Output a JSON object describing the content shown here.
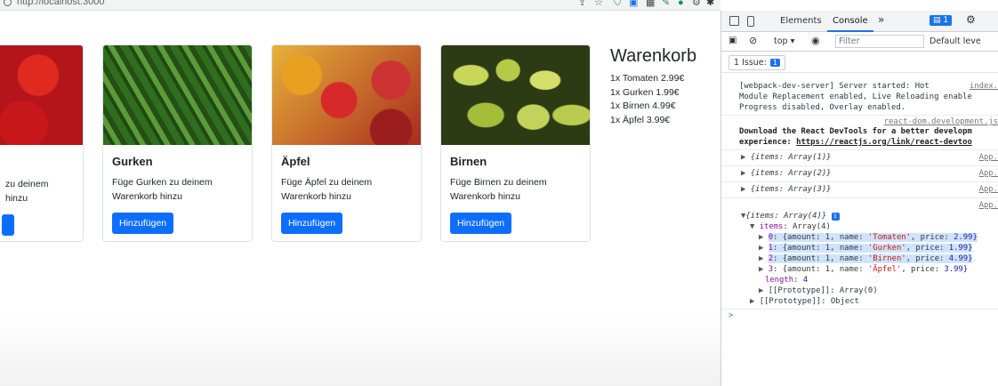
{
  "browser": {
    "url": "http://localhost:3000"
  },
  "products": [
    {
      "name": "",
      "desc_line1": "zu deinem",
      "desc_line2": "hinzu",
      "button": ""
    },
    {
      "name": "Gurken",
      "desc_line1": "Füge Gurken zu deinem",
      "desc_line2": "Warenkorb hinzu",
      "button": "Hinzufügen"
    },
    {
      "name": "Äpfel",
      "desc_line1": "Füge Äpfel zu deinem",
      "desc_line2": "Warenkorb hinzu",
      "button": "Hinzufügen"
    },
    {
      "name": "Birnen",
      "desc_line1": "Füge Birnen zu deinem",
      "desc_line2": "Warenkorb hinzu",
      "button": "Hinzufügen"
    }
  ],
  "cart": {
    "title": "Warenkorb",
    "lines": [
      "1x Tomaten 2.99€",
      "1x Gurken 1.99€",
      "1x Birnen 4.99€",
      "1x Äpfel 3.99€"
    ]
  },
  "devtools": {
    "tabs": [
      "Elements",
      "Console"
    ],
    "more": "»",
    "msg_count": "1",
    "context": "top",
    "filter_placeholder": "Filter",
    "levels": "Default leve",
    "issues": "1 Issue:",
    "issues_count": "1",
    "log_wds_1": "[webpack-dev-server] Server started: Hot",
    "log_wds_src": "index.",
    "log_wds_2": "Module Replacement enabled, Live Reloading enable",
    "log_wds_3": "Progress disabled, Overlay enabled.",
    "log_react_src": "react-dom.development.js",
    "log_react_1": "Download the React DevTools for a better developm",
    "log_react_2a": "experience: ",
    "log_react_2b": "https://reactjs.org/link/react-devtoo",
    "obj1": "{items: Array(1)}",
    "obj2": "{items: Array(2)}",
    "obj3": "{items: Array(3)}",
    "obj4": "{items: Array(4)}",
    "app_src": "App.",
    "items_label": "items",
    "items_type": "Array(4)",
    "e0_idx": "0",
    "e0_a": "{amount: 1, name: ",
    "e0_name": "'Tomaten'",
    "e0_b": ", price: ",
    "e0_price": "2.99}",
    "e1_idx": "1",
    "e1_name": "'Gurken'",
    "e1_price": "1.99}",
    "e2_idx": "2",
    "e2_name": "'Birnen'",
    "e2_price": "4.99}",
    "e3_idx": "3",
    "e3_name": "'Äpfel'",
    "e3_price": "3.99}",
    "length_label": "length",
    "length_val": "4",
    "proto_array": "[[Prototype]]: Array(0)",
    "proto_object": "[[Prototype]]: Object",
    "prompt": ">"
  }
}
